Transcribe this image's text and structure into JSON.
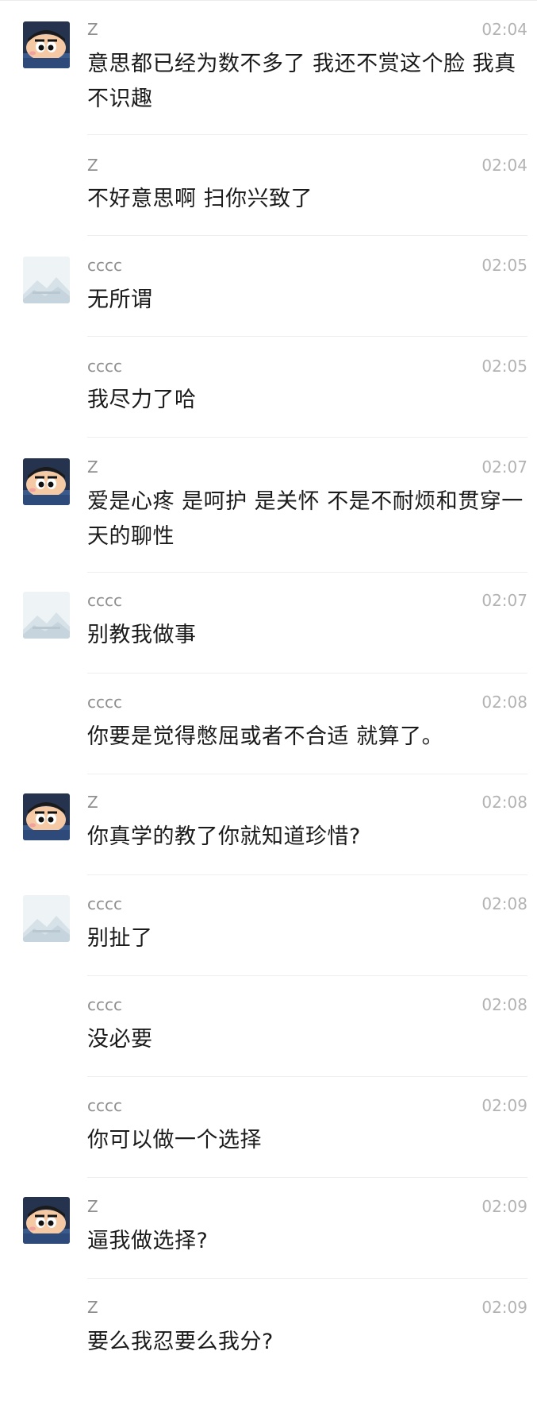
{
  "avatars": {
    "z": "crayon-shin-chan-icon",
    "cccc": "mountain-placeholder-icon"
  },
  "colors": {
    "sender": "#8f8f8f",
    "time": "#b3b3b3",
    "text": "#1b1b1b",
    "divider": "#eeeeee"
  },
  "messages": [
    {
      "sender": "Z",
      "time": "02:04",
      "text": "意思都已经为数不多了 我还不赏这个脸 我真不识趣",
      "avatar": "z"
    },
    {
      "sender": "Z",
      "time": "02:04",
      "text": "不好意思啊 扫你兴致了",
      "avatar": ""
    },
    {
      "sender": "cccc",
      "time": "02:05",
      "text": "无所谓",
      "avatar": "cccc"
    },
    {
      "sender": "cccc",
      "time": "02:05",
      "text": "我尽力了哈",
      "avatar": ""
    },
    {
      "sender": "Z",
      "time": "02:07",
      "text": "爱是心疼 是呵护 是关怀 不是不耐烦和贯穿一天的聊性",
      "avatar": "z"
    },
    {
      "sender": "cccc",
      "time": "02:07",
      "text": "别教我做事",
      "avatar": "cccc"
    },
    {
      "sender": "cccc",
      "time": "02:08",
      "text": "你要是觉得憋屈或者不合适 就算了。",
      "avatar": ""
    },
    {
      "sender": "Z",
      "time": "02:08",
      "text": "你真学的教了你就知道珍惜?",
      "avatar": "z"
    },
    {
      "sender": "cccc",
      "time": "02:08",
      "text": "别扯了",
      "avatar": "cccc"
    },
    {
      "sender": "cccc",
      "time": "02:08",
      "text": "没必要",
      "avatar": ""
    },
    {
      "sender": "cccc",
      "time": "02:09",
      "text": "你可以做一个选择",
      "avatar": ""
    },
    {
      "sender": "Z",
      "time": "02:09",
      "text": "逼我做选择?",
      "avatar": "z"
    },
    {
      "sender": "Z",
      "time": "02:09",
      "text": "要么我忍要么我分?",
      "avatar": ""
    }
  ]
}
